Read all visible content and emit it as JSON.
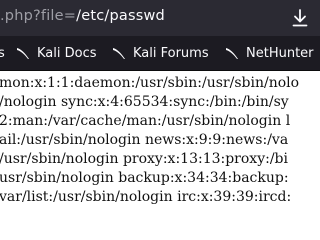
{
  "urlbar": {
    "url_prefix": ".php?file=",
    "url_path": "/etc/passwd",
    "download_icon": "download-icon"
  },
  "bookmarks": [
    {
      "label": "s",
      "icon": "kali-dragon-icon"
    },
    {
      "label": "Kali Docs",
      "icon": "kali-dragon-icon"
    },
    {
      "label": "Kali Forums",
      "icon": "kali-dragon-icon"
    },
    {
      "label": "NetHunter",
      "icon": "kali-dragon-icon"
    }
  ],
  "colors": {
    "urlbar_bg": "#2b2a33",
    "toolbar_bg": "#1c1b22",
    "page_bg": "#ffffff",
    "page_text": "#111111"
  },
  "content": {
    "lines": [
      "mon:x:1:1:daemon:/usr/sbin:/usr/sbin/nolo",
      "/nologin sync:x:4:65534:sync:/bin:/bin/sy",
      "2:man:/var/cache/man:/usr/sbin/nologin l",
      "ail:/usr/sbin/nologin news:x:9:9:news:/va",
      "/usr/sbin/nologin proxy:x:13:13:proxy:/bi",
      "usr/sbin/nologin backup:x:34:34:backup:",
      "var/list:/usr/sbin/nologin irc:x:39:39:ircd:"
    ]
  }
}
